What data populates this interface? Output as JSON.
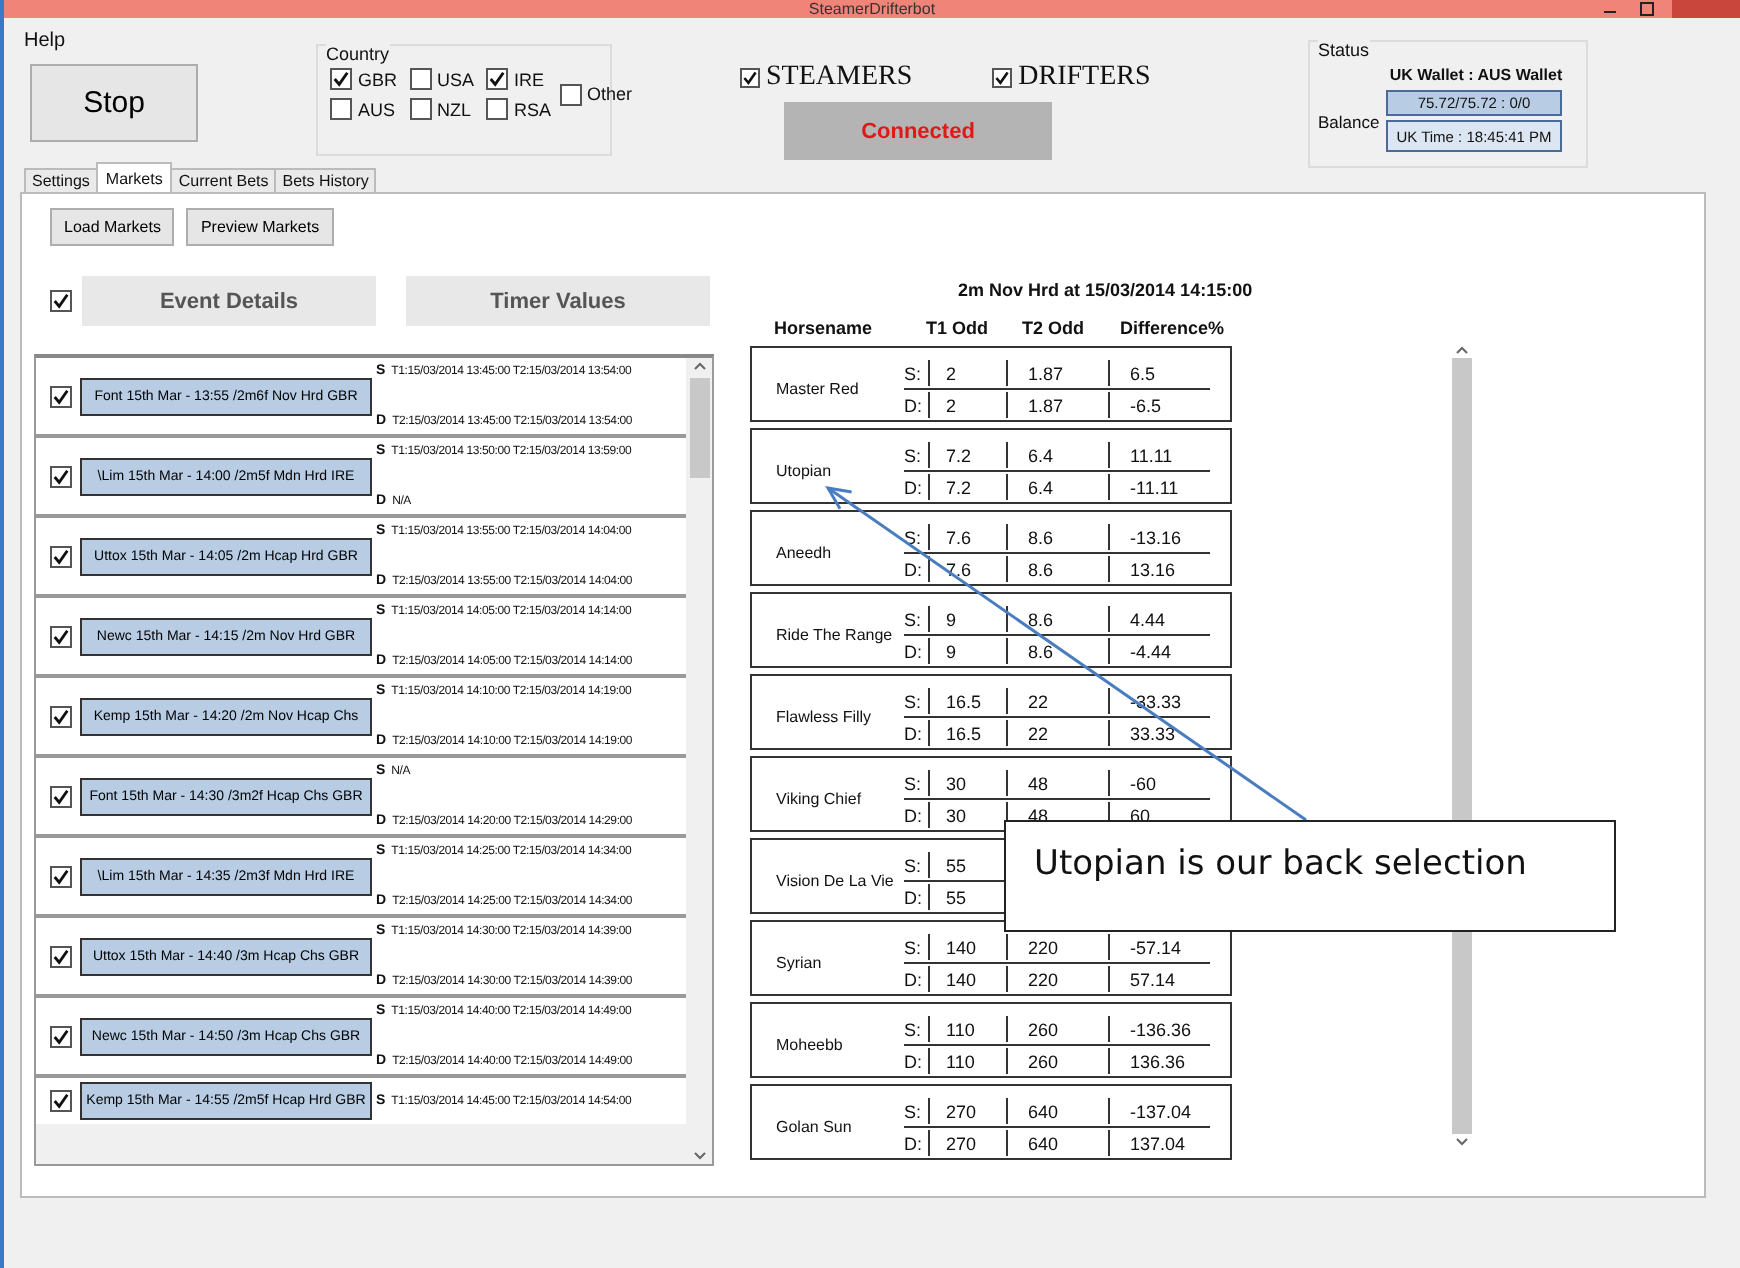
{
  "window": {
    "title": "SteamerDrifterbot"
  },
  "menu": [
    "Help"
  ],
  "stop_button": "Stop",
  "country": {
    "title": "Country",
    "options": [
      {
        "label": "GBR",
        "checked": true
      },
      {
        "label": "USA",
        "checked": false
      },
      {
        "label": "IRE",
        "checked": true
      },
      {
        "label": "AUS",
        "checked": false
      },
      {
        "label": "NZL",
        "checked": false
      },
      {
        "label": "RSA",
        "checked": false
      }
    ],
    "other": {
      "label": "Other",
      "checked": false
    }
  },
  "filters": [
    {
      "label": "STEAMERS",
      "checked": true
    },
    {
      "label": "DRIFTERS",
      "checked": true
    }
  ],
  "connection_status": "Connected",
  "status": {
    "title": "Status",
    "wallet_heading": "UK Wallet : AUS Wallet",
    "balance_label": "Balance",
    "balance": "75.72/75.72 : 0/0",
    "uk_time": "UK Time : 18:45:41 PM"
  },
  "tabs": [
    {
      "label": "Settings",
      "selected": false
    },
    {
      "label": "Markets",
      "selected": true
    },
    {
      "label": "Current Bets",
      "selected": false
    },
    {
      "label": "Bets History",
      "selected": false
    }
  ],
  "market_buttons": [
    "Load Markets",
    "Preview Markets"
  ],
  "events_header": {
    "checked": true,
    "columns": [
      "Event Details",
      "Timer Values"
    ]
  },
  "events": [
    {
      "checked": true,
      "name": "Font 15th Mar - 13:55 /2m6f Nov Hrd GBR",
      "lines": [
        {
          "label": "S",
          "text": "T1:15/03/2014 13:45:00 T2:15/03/2014 13:54:00"
        },
        {
          "label": "D",
          "text": "T2:15/03/2014 13:45:00 T2:15/03/2014 13:54:00"
        }
      ]
    },
    {
      "checked": true,
      "name": "\\Lim 15th Mar - 14:00 /2m5f Mdn Hrd IRE",
      "lines": [
        {
          "label": "S",
          "text": "T1:15/03/2014 13:50:00 T2:15/03/2014 13:59:00"
        },
        {
          "label": "D",
          "text": "N/A"
        }
      ]
    },
    {
      "checked": true,
      "name": "Uttox 15th Mar - 14:05 /2m Hcap Hrd GBR",
      "lines": [
        {
          "label": "S",
          "text": "T1:15/03/2014 13:55:00 T2:15/03/2014 14:04:00"
        },
        {
          "label": "D",
          "text": "T2:15/03/2014 13:55:00 T2:15/03/2014 14:04:00"
        }
      ]
    },
    {
      "checked": true,
      "name": "Newc 15th Mar - 14:15 /2m Nov Hrd GBR",
      "lines": [
        {
          "label": "S",
          "text": "T1:15/03/2014 14:05:00 T2:15/03/2014 14:14:00"
        },
        {
          "label": "D",
          "text": "T2:15/03/2014 14:05:00 T2:15/03/2014 14:14:00"
        }
      ]
    },
    {
      "checked": true,
      "name": "Kemp 15th Mar - 14:20 /2m Nov Hcap Chs",
      "lines": [
        {
          "label": "S",
          "text": "T1:15/03/2014 14:10:00 T2:15/03/2014 14:19:00"
        },
        {
          "label": "D",
          "text": "T2:15/03/2014 14:10:00 T2:15/03/2014 14:19:00"
        }
      ]
    },
    {
      "checked": true,
      "name": "Font 15th Mar - 14:30 /3m2f Hcap Chs GBR",
      "lines": [
        {
          "label": "S",
          "text": "N/A"
        },
        {
          "label": "D",
          "text": "T2:15/03/2014 14:20:00 T2:15/03/2014 14:29:00"
        }
      ]
    },
    {
      "checked": true,
      "name": "\\Lim 15th Mar - 14:35 /2m3f Mdn Hrd IRE",
      "lines": [
        {
          "label": "S",
          "text": "T1:15/03/2014 14:25:00 T2:15/03/2014 14:34:00"
        },
        {
          "label": "D",
          "text": "T2:15/03/2014 14:25:00 T2:15/03/2014 14:34:00"
        }
      ]
    },
    {
      "checked": true,
      "name": "Uttox 15th Mar - 14:40 /3m Hcap Chs GBR",
      "lines": [
        {
          "label": "S",
          "text": "T1:15/03/2014 14:30:00 T2:15/03/2014 14:39:00"
        },
        {
          "label": "D",
          "text": "T2:15/03/2014 14:30:00 T2:15/03/2014 14:39:00"
        }
      ]
    },
    {
      "checked": true,
      "name": "Newc 15th Mar - 14:50 /3m Hcap Chs GBR",
      "lines": [
        {
          "label": "S",
          "text": "T1:15/03/2014 14:40:00 T2:15/03/2014 14:49:00"
        },
        {
          "label": "D",
          "text": "T2:15/03/2014 14:40:00 T2:15/03/2014 14:49:00"
        }
      ]
    },
    {
      "checked": true,
      "name": "Kemp 15th Mar - 14:55 /2m5f Hcap Hrd GBR",
      "lines": [
        {
          "label": "S",
          "text": "T1:15/03/2014 14:45:00 T2:15/03/2014 14:54:00"
        }
      ]
    }
  ],
  "market": {
    "title": "2m Nov Hrd at 15/03/2014 14:15:00",
    "columns": [
      "Horsename",
      "T1 Odd",
      "T2 Odd",
      "Difference%"
    ],
    "runners": [
      {
        "name": "Master Red",
        "rows": [
          {
            "label": "S:",
            "t1": "2",
            "t2": "1.87",
            "diff": "6.5"
          },
          {
            "label": "D:",
            "t1": "2",
            "t2": "1.87",
            "diff": "-6.5"
          }
        ]
      },
      {
        "name": "Utopian",
        "rows": [
          {
            "label": "S:",
            "t1": "7.2",
            "t2": "6.4",
            "diff": "11.11"
          },
          {
            "label": "D:",
            "t1": "7.2",
            "t2": "6.4",
            "diff": "-11.11"
          }
        ]
      },
      {
        "name": "Aneedh",
        "rows": [
          {
            "label": "S:",
            "t1": "7.6",
            "t2": "8.6",
            "diff": "-13.16"
          },
          {
            "label": "D:",
            "t1": "7.6",
            "t2": "8.6",
            "diff": "13.16"
          }
        ]
      },
      {
        "name": "Ride The Range",
        "rows": [
          {
            "label": "S:",
            "t1": "9",
            "t2": "8.6",
            "diff": "4.44"
          },
          {
            "label": "D:",
            "t1": "9",
            "t2": "8.6",
            "diff": "-4.44"
          }
        ]
      },
      {
        "name": "Flawless Filly",
        "rows": [
          {
            "label": "S:",
            "t1": "16.5",
            "t2": "22",
            "diff": "-33.33"
          },
          {
            "label": "D:",
            "t1": "16.5",
            "t2": "22",
            "diff": "33.33"
          }
        ]
      },
      {
        "name": "Viking Chief",
        "rows": [
          {
            "label": "S:",
            "t1": "30",
            "t2": "48",
            "diff": "-60"
          },
          {
            "label": "D:",
            "t1": "30",
            "t2": "48",
            "diff": "60"
          }
        ]
      },
      {
        "name": "Vision De La Vie",
        "rows": [
          {
            "label": "S:",
            "t1": "55"
          },
          {
            "label": "D:",
            "t1": "55"
          }
        ]
      },
      {
        "name": "Syrian",
        "rows": [
          {
            "label": "S:",
            "t1": "140",
            "t2": "220",
            "diff": "-57.14"
          },
          {
            "label": "D:",
            "t1": "140",
            "t2": "220",
            "diff": "57.14"
          }
        ]
      },
      {
        "name": "Moheebb",
        "rows": [
          {
            "label": "S:",
            "t1": "110",
            "t2": "260",
            "diff": "-136.36"
          },
          {
            "label": "D:",
            "t1": "110",
            "t2": "260",
            "diff": "136.36"
          }
        ]
      },
      {
        "name": "Golan Sun",
        "rows": [
          {
            "label": "S:",
            "t1": "270",
            "t2": "640",
            "diff": "-137.04"
          },
          {
            "label": "D:",
            "t1": "270",
            "t2": "640",
            "diff": "137.04"
          }
        ]
      }
    ]
  },
  "annotation": {
    "text": "Utopian is our back selection"
  }
}
